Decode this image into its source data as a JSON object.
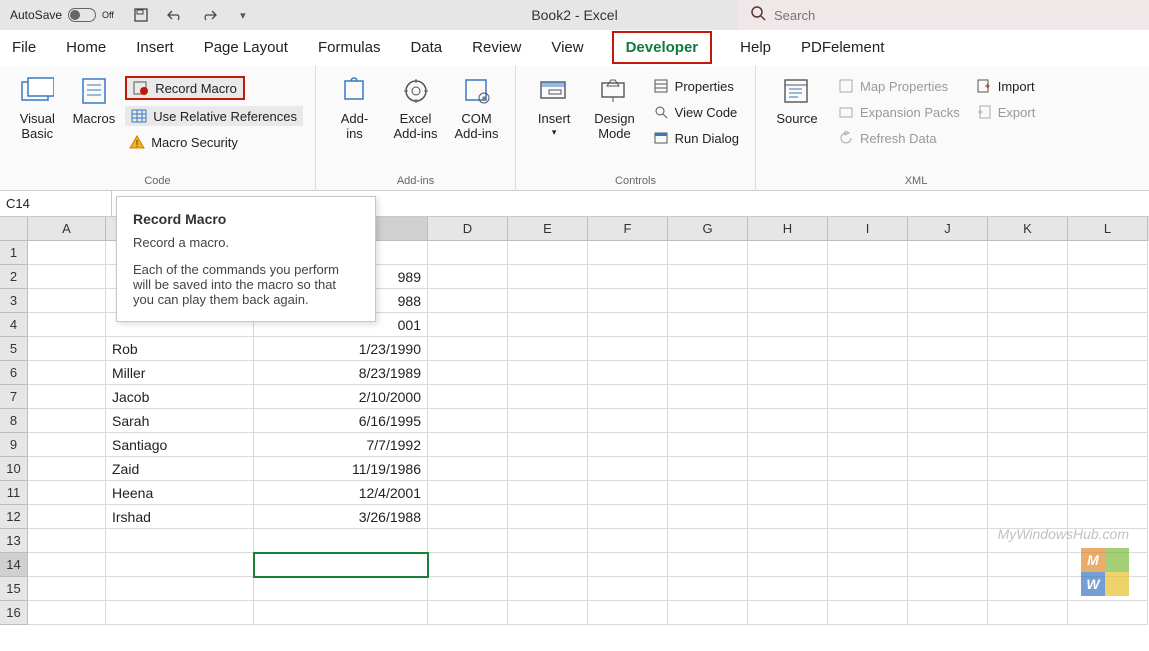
{
  "titlebar": {
    "autosave_label": "AutoSave",
    "autosave_state": "Off",
    "doc_title": "Book2  -  Excel",
    "search_placeholder": "Search"
  },
  "tabs": [
    "File",
    "Home",
    "Insert",
    "Page Layout",
    "Formulas",
    "Data",
    "Review",
    "View",
    "Developer",
    "Help",
    "PDFelement"
  ],
  "active_tab": "Developer",
  "ribbon": {
    "code": {
      "label": "Code",
      "visual_basic": "Visual Basic",
      "macros": "Macros",
      "record_macro": "Record Macro",
      "relative_refs": "Use Relative References",
      "macro_security": "Macro Security"
    },
    "addins": {
      "label": "Add-ins",
      "addins": "Add-ins",
      "excel_addins": "Excel Add-ins",
      "com_addins": "COM Add-ins"
    },
    "controls": {
      "label": "Controls",
      "insert": "Insert",
      "design_mode": "Design Mode",
      "properties": "Properties",
      "view_code": "View Code",
      "run_dialog": "Run Dialog"
    },
    "xml": {
      "label": "XML",
      "source": "Source",
      "map_props": "Map Properties",
      "expansion": "Expansion Packs",
      "refresh": "Refresh Data",
      "import": "Import",
      "export": "Export"
    }
  },
  "tooltip": {
    "title": "Record Macro",
    "subtitle": "Record a macro.",
    "body": "Each of the commands you perform will be saved into the macro so that you can play them back again."
  },
  "formula_bar": {
    "cell_ref": "C14"
  },
  "columns": [
    "A",
    "B",
    "C",
    "D",
    "E",
    "F",
    "G",
    "H",
    "I",
    "J",
    "K",
    "L"
  ],
  "column_widths": {
    "A": 78,
    "B": 148,
    "C": 174,
    "default": 80
  },
  "row_count": 16,
  "selected": {
    "row": 14,
    "col": "C"
  },
  "cells": {
    "B5": "Rob",
    "C5": "1/23/1990",
    "B6": "Miller",
    "C6": "8/23/1989",
    "B7": "Jacob",
    "C7": "2/10/2000",
    "B8": "Sarah",
    "C8": "6/16/1995",
    "B9": "Santiago",
    "C9": "7/7/1992",
    "B10": "Zaid",
    "C10": "11/19/1986",
    "B11": "Heena",
    "C11": "12/4/2001",
    "B12": "Irshad",
    "C12": "3/26/1988",
    "C2": "989",
    "C3": "988",
    "C4": "001"
  },
  "watermark": {
    "text": "MyWindowsHub.com",
    "m": "M",
    "w": "W"
  }
}
